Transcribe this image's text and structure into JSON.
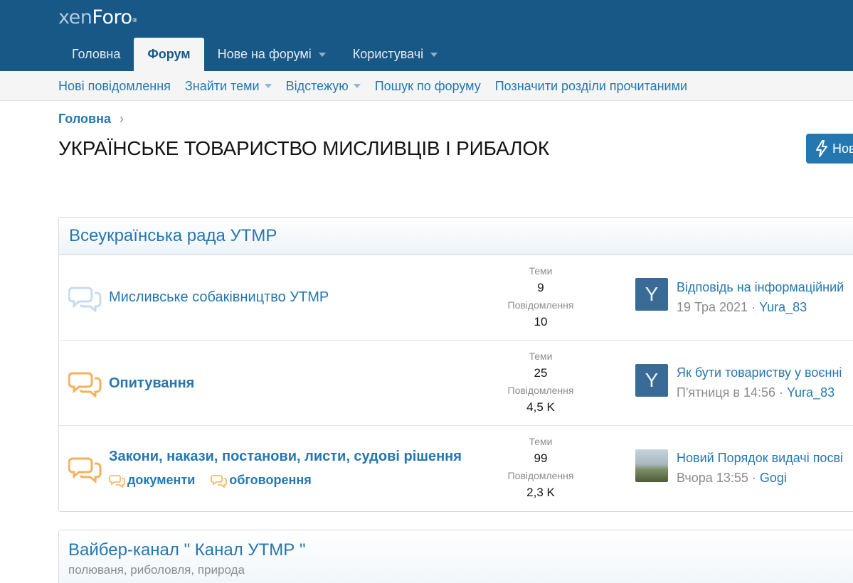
{
  "header": {
    "logo_main": "xen",
    "logo_accent": "Foro",
    "logo_mark": "®"
  },
  "nav": {
    "tabs": [
      {
        "label": "Головна",
        "active": false,
        "dropdown": false
      },
      {
        "label": "Форум",
        "active": true,
        "dropdown": false
      },
      {
        "label": "Нове на форумі",
        "active": false,
        "dropdown": true
      },
      {
        "label": "Користувачі",
        "active": false,
        "dropdown": true
      }
    ]
  },
  "subnav": {
    "links": [
      {
        "label": "Нові повідомлення",
        "dropdown": false
      },
      {
        "label": "Знайти теми",
        "dropdown": true
      },
      {
        "label": "Відстежую",
        "dropdown": true
      },
      {
        "label": "Пошук по форуму",
        "dropdown": false
      },
      {
        "label": "Позначити розділи прочитаними",
        "dropdown": false
      }
    ]
  },
  "breadcrumb": {
    "label": "Головна"
  },
  "page": {
    "title": "УКРАЇНСЬКЕ ТОВАРИСТВО МИСЛИВЦІВ І РИБАЛОК",
    "new_button_label": "Нов"
  },
  "category1": {
    "title": "Всеукраїнська рада УТМР",
    "nodes": [
      {
        "title": "Мисливське собаківництво УТМР",
        "unread": false,
        "threads_label": "Теми",
        "threads": "9",
        "messages_label": "Повідомлення",
        "messages": "10",
        "last_title": "Відповідь на інформаційний",
        "last_date": "19 Тра 2021",
        "last_user": "Yura_83",
        "avatar_letter": "Y"
      },
      {
        "title": "Опитування",
        "unread": true,
        "threads_label": "Теми",
        "threads": "25",
        "messages_label": "Повідомлення",
        "messages": "4,5 K",
        "last_title": "Як бути товариству у воєнні",
        "last_date": "П'ятниця в 14:56",
        "last_user": "Yura_83",
        "avatar_letter": "Y"
      },
      {
        "title": "Закони, накази, постанови, листи, судові рішення",
        "unread": true,
        "sub_forums": [
          "документи",
          "обговорення"
        ],
        "threads_label": "Теми",
        "threads": "99",
        "messages_label": "Повідомлення",
        "messages": "2,3 K",
        "last_title": "Новий Порядок видачі посві",
        "last_date": "Вчора 13:55",
        "last_user": "Gogi",
        "avatar_letter": ""
      }
    ]
  },
  "category2": {
    "title": "Вайбер-канал \" Канал УТМР \"",
    "description": "полюваня, риболовля, природа"
  },
  "colors": {
    "header_bg": "#185886",
    "link": "#2577b1",
    "unread_icon": "#f5b15a",
    "read_icon": "#c7dcef",
    "avatar_bg": "#3a6b96"
  }
}
